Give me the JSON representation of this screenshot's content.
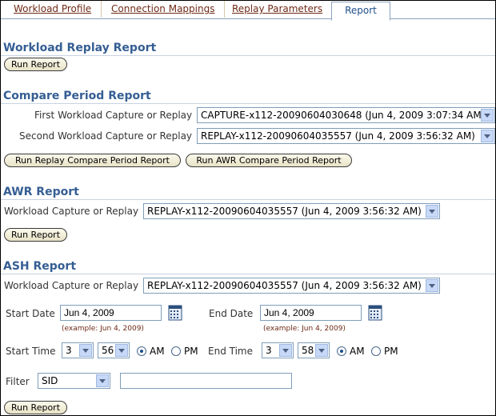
{
  "tabs": [
    {
      "label": "Workload Profile"
    },
    {
      "label": "Connection Mappings"
    },
    {
      "label": "Replay Parameters"
    },
    {
      "label": "Report"
    }
  ],
  "workload_replay": {
    "title": "Workload Replay Report",
    "run_label": "Run Report"
  },
  "compare_period": {
    "title": "Compare Period Report",
    "first_label": "First Workload Capture or Replay",
    "first_value": "CAPTURE-x112-20090604030648 (Jun 4, 2009 3:07:34 AM)",
    "second_label": "Second Workload Capture or Replay",
    "second_value": "REPLAY-x112-20090604035557 (Jun 4, 2009 3:56:32 AM)",
    "run_replay_label": "Run Replay Compare Period Report",
    "run_awr_label": "Run AWR Compare Period Report"
  },
  "awr": {
    "title": "AWR Report",
    "capture_label": "Workload Capture or Replay",
    "capture_value": "REPLAY-x112-20090604035557 (Jun 4, 2009 3:56:32 AM)",
    "run_label": "Run Report"
  },
  "ash": {
    "title": "ASH Report",
    "capture_label": "Workload Capture or Replay",
    "capture_value": "REPLAY-x112-20090604035557 (Jun 4, 2009 3:56:32 AM)",
    "start_date_label": "Start Date",
    "start_date_value": "Jun 4, 2009",
    "start_date_hint": "(example: Jun 4, 2009)",
    "end_date_label": "End Date",
    "end_date_value": "Jun 4, 2009",
    "end_date_hint": "(example: Jun 4, 2009)",
    "start_time_label": "Start Time",
    "start_hour": "3",
    "start_minute": "56",
    "end_time_label": "End Time",
    "end_hour": "3",
    "end_minute": "58",
    "am_label": "AM",
    "pm_label": "PM",
    "filter_label": "Filter",
    "filter_value": "SID",
    "filter_text": "",
    "run_label": "Run Report"
  }
}
